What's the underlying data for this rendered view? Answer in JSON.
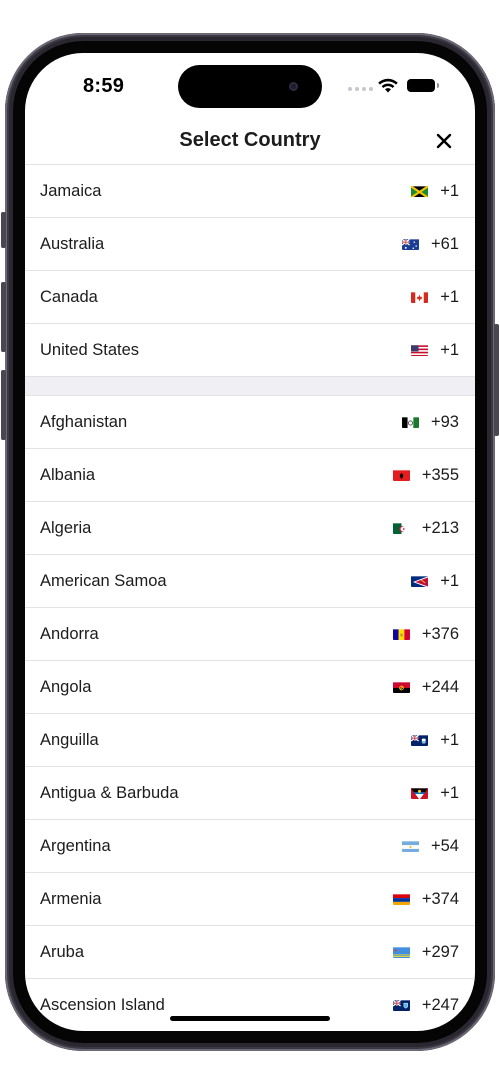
{
  "status_bar": {
    "time": "8:59",
    "icons": [
      "signal-dots-icon",
      "wifi-icon",
      "battery-icon"
    ]
  },
  "header": {
    "title": "Select Country",
    "close_icon": "close-icon"
  },
  "favorites": [
    {
      "name": "Jamaica",
      "code": "+1",
      "flag": "jamaica-flag-icon"
    },
    {
      "name": "Australia",
      "code": "+61",
      "flag": "australia-flag-icon"
    },
    {
      "name": "Canada",
      "code": "+1",
      "flag": "canada-flag-icon"
    },
    {
      "name": "United States",
      "code": "+1",
      "flag": "united-states-flag-icon"
    }
  ],
  "countries": [
    {
      "name": "Afghanistan",
      "code": "+93",
      "flag": "afghanistan-flag-icon"
    },
    {
      "name": "Albania",
      "code": "+355",
      "flag": "albania-flag-icon"
    },
    {
      "name": "Algeria",
      "code": "+213",
      "flag": "algeria-flag-icon"
    },
    {
      "name": "American Samoa",
      "code": "+1",
      "flag": "american-samoa-flag-icon"
    },
    {
      "name": "Andorra",
      "code": "+376",
      "flag": "andorra-flag-icon"
    },
    {
      "name": "Angola",
      "code": "+244",
      "flag": "angola-flag-icon"
    },
    {
      "name": "Anguilla",
      "code": "+1",
      "flag": "anguilla-flag-icon"
    },
    {
      "name": "Antigua & Barbuda",
      "code": "+1",
      "flag": "antigua-barbuda-flag-icon"
    },
    {
      "name": "Argentina",
      "code": "+54",
      "flag": "argentina-flag-icon"
    },
    {
      "name": "Armenia",
      "code": "+374",
      "flag": "armenia-flag-icon"
    },
    {
      "name": "Aruba",
      "code": "+297",
      "flag": "aruba-flag-icon"
    },
    {
      "name": "Ascension Island",
      "code": "+247",
      "flag": "ascension-island-flag-icon"
    }
  ],
  "colors": {
    "text": "#1c1c1e",
    "separator": "#e3e3e6",
    "section_gap": "#efeff4",
    "device_frame": "#2a2730"
  }
}
